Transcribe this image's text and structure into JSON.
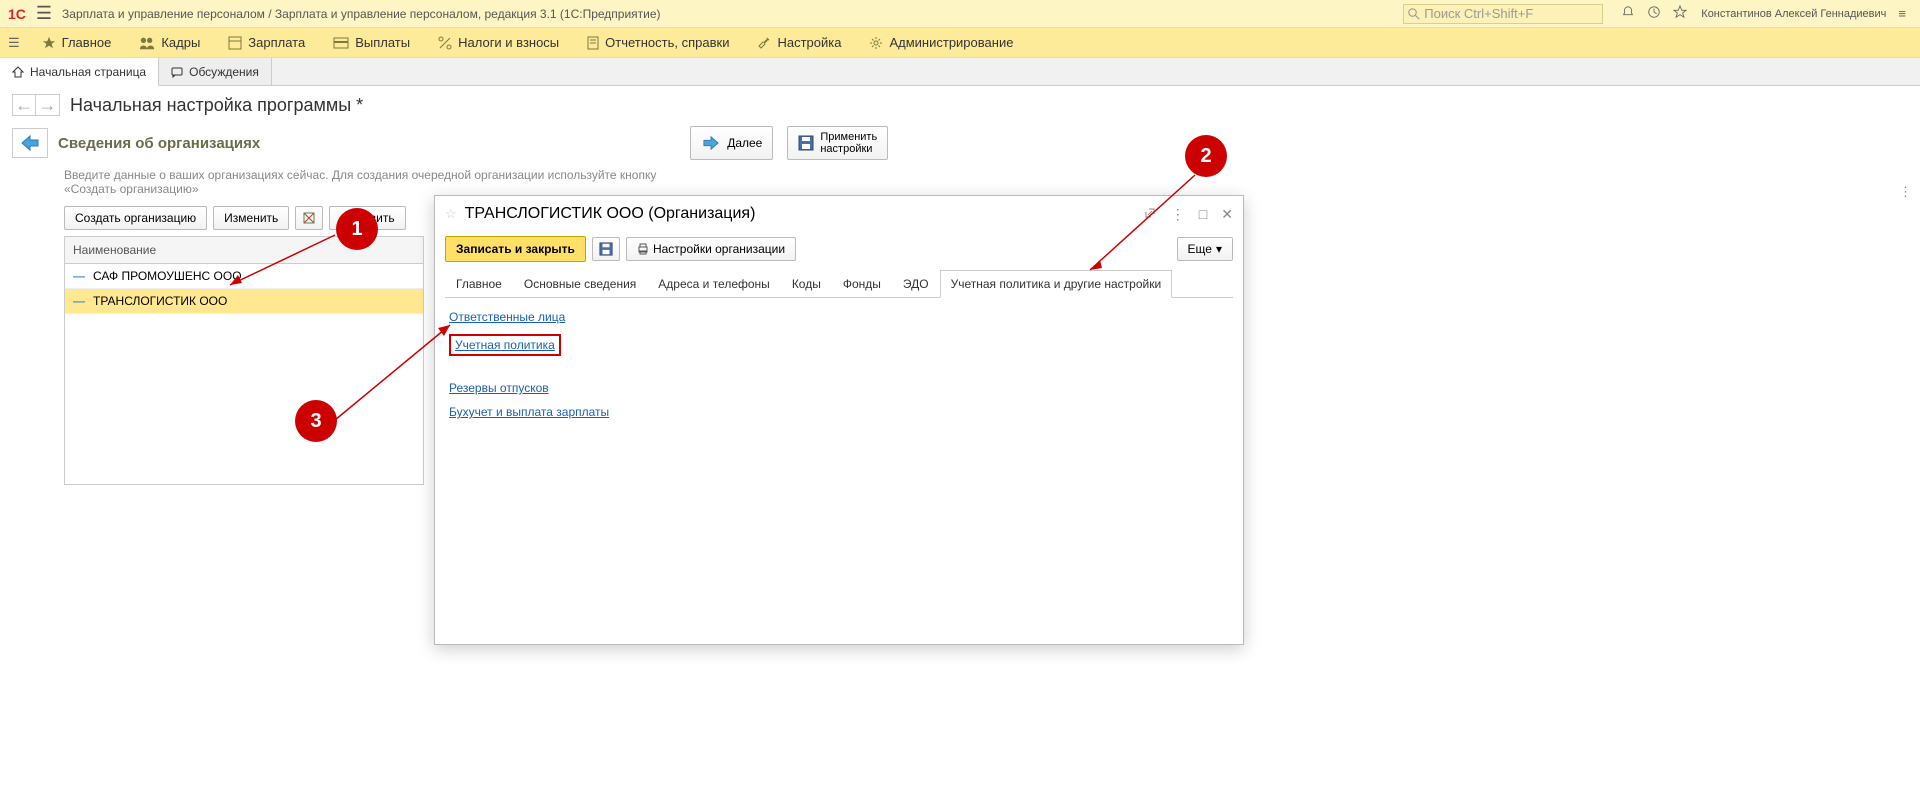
{
  "titlebar": {
    "title": "Зарплата и управление персоналом / Зарплата и управление персоналом, редакция 3.1  (1С:Предприятие)",
    "search_placeholder": "Поиск Ctrl+Shift+F",
    "user": "Константинов Алексей Геннадиевич"
  },
  "menubar": {
    "items": [
      "Главное",
      "Кадры",
      "Зарплата",
      "Выплаты",
      "Налоги и взносы",
      "Отчетность, справки",
      "Настройка",
      "Администрирование"
    ]
  },
  "tabs": {
    "home": "Начальная страница",
    "discuss": "Обсуждения"
  },
  "page": {
    "breadcrumb": "Начальная настройка программы *",
    "section_title": "Сведения об организациях",
    "next_btn": "Далее",
    "apply_btn_l1": "Применить",
    "apply_btn_l2": "настройки",
    "hint": "Введите данные о ваших организациях сейчас. Для создания очередной организации используйте кнопку «Создать организацию»",
    "toolbar": {
      "create": "Создать организацию",
      "edit": "Изменить",
      "refresh": "Обновить"
    },
    "table": {
      "header": "Наименование",
      "rows": [
        "САФ ПРОМОУШЕНС ООО",
        "ТРАНСЛОГИСТИК ООО"
      ]
    }
  },
  "dialog": {
    "title": "ТРАНСЛОГИСТИК ООО (Организация)",
    "save_close": "Записать и закрыть",
    "org_settings": "Настройки организации",
    "more": "Еще",
    "tabs": [
      "Главное",
      "Основные сведения",
      "Адреса и телефоны",
      "Коды",
      "Фонды",
      "ЭДО",
      "Учетная политика и другие настройки"
    ],
    "links": {
      "resp": "Ответственные лица",
      "policy": "Учетная политика",
      "reserve": "Резервы отпусков",
      "acc": "Бухучет и выплата зарплаты"
    }
  },
  "callouts": {
    "c1": "1",
    "c2": "2",
    "c3": "3"
  }
}
